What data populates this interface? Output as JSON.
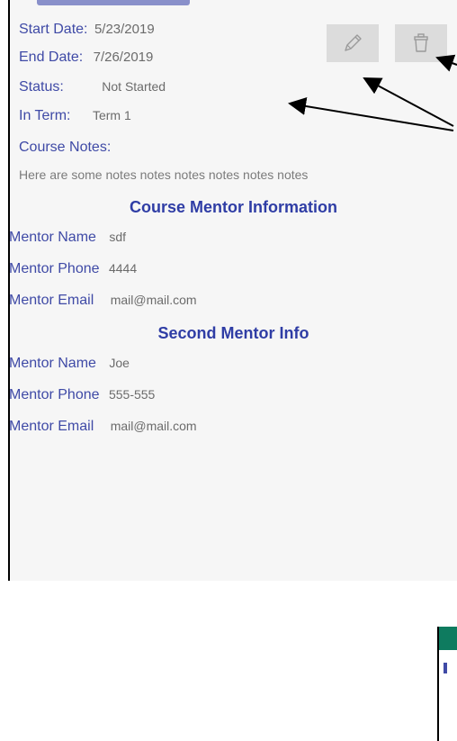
{
  "course": {
    "start_label": "Start Date:",
    "start_value": "5/23/2019",
    "end_label": "End Date:",
    "end_value": "7/26/2019",
    "status_label": "Status:",
    "status_value": "Not Started",
    "term_label": "In Term:",
    "term_value": "Term 1",
    "notes_label": "Course Notes:",
    "notes_value": "Here are some notes notes notes notes notes notes"
  },
  "actions": {
    "edit_icon": "pencil-icon",
    "delete_icon": "trash-icon"
  },
  "mentor1": {
    "section_title": "Course Mentor Information",
    "name_label": "Mentor Name",
    "name_value": "sdf",
    "phone_label": "Mentor Phone",
    "phone_value": "4444",
    "email_label": "Mentor Email",
    "email_value": "mail@mail.com"
  },
  "mentor2": {
    "section_title": "Second Mentor Info",
    "name_label": "Mentor Name",
    "name_value": "Joe",
    "phone_label": "Mentor Phone",
    "phone_value": "555-555",
    "email_label": "Mentor Email",
    "email_value": "mail@mail.com"
  },
  "colors": {
    "label": "#3f4aa6",
    "section": "#2f3da5",
    "value": "#6b6b6b",
    "screen_bg": "#f6f6f6",
    "button_bg": "#dcdcdc",
    "toolbar_green": "#0e7b5f"
  }
}
